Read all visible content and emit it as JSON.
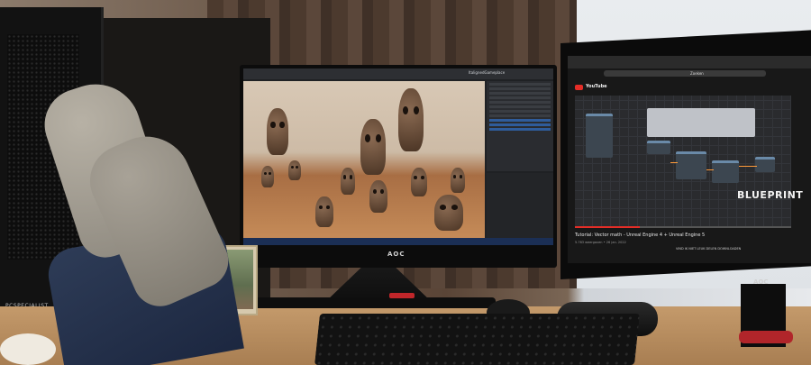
{
  "photo": {
    "subject": "desk setup with two monitors and feet up",
    "pc_brand": "PCSPECIALIST",
    "left_monitor": {
      "logo": "AOC",
      "app_window_title": "ItalignedGameplace",
      "panels": [
        "Outliner",
        "Details"
      ],
      "highlight_color": "#2f5c9b"
    },
    "right_monitor": {
      "logo": "AOC",
      "browser_url": "Zoeken",
      "site_name": "YouTube",
      "video_overlay_text": "BLUEPRINT",
      "video_title": "Tutorial: Vector math - Unreal Engine 4 + Unreal Engine 5",
      "video_meta": "5.763 weergaven • 26 jan. 2022",
      "video_actions": "VIND IK NIET LEUK   DELEN   DOWNLOADEN",
      "accent_color": "#e52d27",
      "wire_color": "#ff9b3a"
    },
    "stand_accent_color": "#c0262a"
  }
}
